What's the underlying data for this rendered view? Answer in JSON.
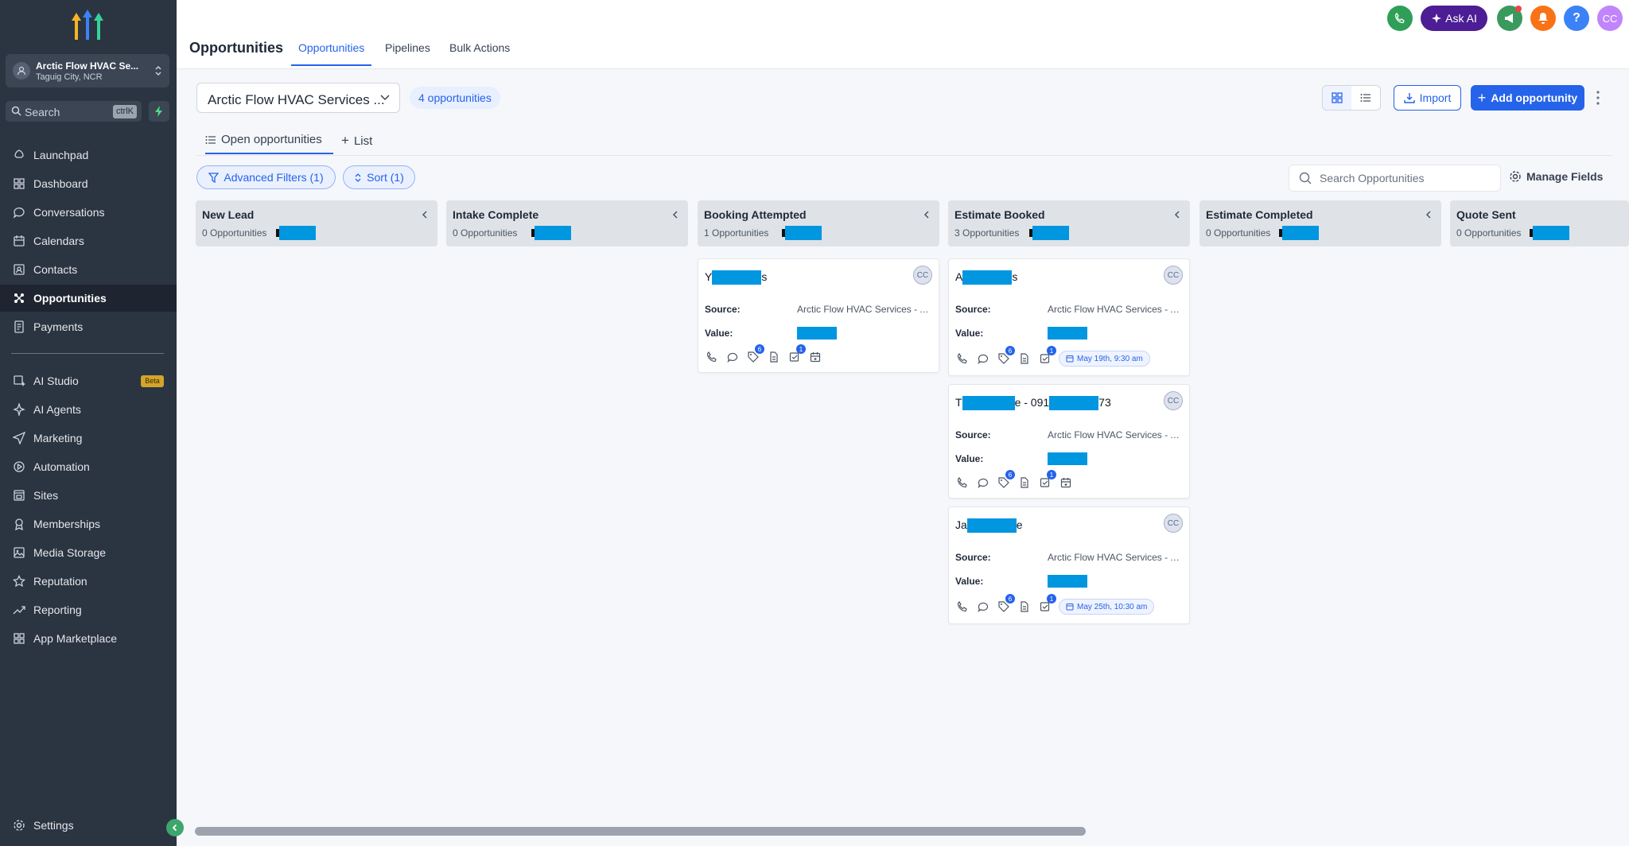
{
  "sidebar": {
    "account": {
      "name": "Arctic Flow HVAC Se...",
      "location": "Taguig City, NCR"
    },
    "search": {
      "placeholder": "Search",
      "shortcut": "ctrlK"
    },
    "items": [
      {
        "label": "Launchpad",
        "icon": "rocket-icon"
      },
      {
        "label": "Dashboard",
        "icon": "grid-icon"
      },
      {
        "label": "Conversations",
        "icon": "chat-icon"
      },
      {
        "label": "Calendars",
        "icon": "calendar-icon"
      },
      {
        "label": "Contacts",
        "icon": "contacts-icon"
      },
      {
        "label": "Opportunities",
        "icon": "opportunities-icon",
        "active": true
      },
      {
        "label": "Payments",
        "icon": "payments-icon"
      }
    ],
    "items2": [
      {
        "label": "AI Studio",
        "icon": "ai-studio-icon",
        "badge": "Beta"
      },
      {
        "label": "AI Agents",
        "icon": "sparkle-icon"
      },
      {
        "label": "Marketing",
        "icon": "send-icon"
      },
      {
        "label": "Automation",
        "icon": "automation-icon"
      },
      {
        "label": "Sites",
        "icon": "sites-icon"
      },
      {
        "label": "Memberships",
        "icon": "membership-icon"
      },
      {
        "label": "Media Storage",
        "icon": "media-icon"
      },
      {
        "label": "Reputation",
        "icon": "star-icon"
      },
      {
        "label": "Reporting",
        "icon": "chart-icon"
      },
      {
        "label": "App Marketplace",
        "icon": "apps-icon"
      }
    ],
    "settings": "Settings"
  },
  "header": {
    "title": "Opportunities",
    "tabs": [
      "Opportunities",
      "Pipelines",
      "Bulk Actions"
    ],
    "ask_ai": "Ask AI",
    "user_initials": "CC"
  },
  "toolbar": {
    "pipeline": "Arctic Flow HVAC Services ...",
    "count": "4 opportunities",
    "import": "Import",
    "add": "Add opportunity",
    "subtabs": [
      "Open opportunities",
      "List"
    ],
    "filters": "Advanced Filters (1)",
    "sort": "Sort (1)",
    "search_placeholder": "Search Opportunities",
    "manage_fields": "Manage Fields"
  },
  "columns": [
    {
      "title": "New Lead",
      "count": "0 Opportunities"
    },
    {
      "title": "Intake Complete",
      "count": "0 Opportunities"
    },
    {
      "title": "Booking Attempted",
      "count": "1 Opportunities"
    },
    {
      "title": "Estimate Booked",
      "count": "3 Opportunities"
    },
    {
      "title": "Estimate Completed",
      "count": "0 Opportunities"
    },
    {
      "title": "Quote Sent",
      "count": "0 Opportunities"
    }
  ],
  "cards": [
    {
      "name_start": "Y",
      "name_end": "s",
      "source_label": "Source:",
      "source": "Arctic Flow HVAC Services - Ai...",
      "value_label": "Value:",
      "avatar": "CC",
      "badge1": "6",
      "badge2": "1",
      "date": ""
    },
    {
      "name_start": "A",
      "name_end": "s",
      "source_label": "Source:",
      "source": "Arctic Flow HVAC Services - Ai...",
      "value_label": "Value:",
      "avatar": "CC",
      "badge1": "6",
      "badge2": "1",
      "date": "May 19th, 9:30 am"
    },
    {
      "name_start": "T",
      "name_mid": "e - 091",
      "name_end": "73",
      "source_label": "Source:",
      "source": "Arctic Flow HVAC Services - Ai...",
      "value_label": "Value:",
      "avatar": "CC",
      "badge1": "6",
      "badge2": "1",
      "date": ""
    },
    {
      "name_start": "Ja",
      "name_end": "e",
      "source_label": "Source:",
      "source": "Arctic Flow HVAC Services - Ai...",
      "value_label": "Value:",
      "avatar": "CC",
      "badge1": "6",
      "badge2": "1",
      "date": "May 25th, 10:30 am"
    }
  ]
}
